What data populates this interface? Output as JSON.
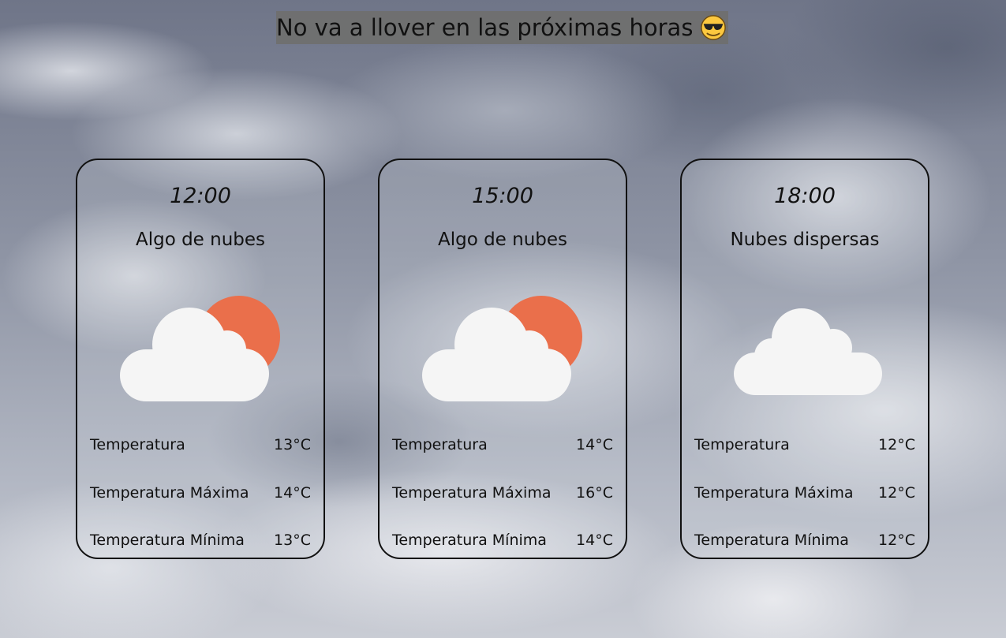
{
  "alert": {
    "text": "No va a llover en las próximas horas",
    "emoji": "sunglasses-emoji"
  },
  "labels": {
    "temp": "Temperatura",
    "temp_max": "Temperatura Máxima",
    "temp_min": "Temperatura Mínima"
  },
  "forecasts": [
    {
      "time": "12:00",
      "description": "Algo de nubes",
      "icon": "partly-cloudy-icon",
      "temp": "13°C",
      "temp_max": "14°C",
      "temp_min": "13°C"
    },
    {
      "time": "15:00",
      "description": "Algo de nubes",
      "icon": "partly-cloudy-icon",
      "temp": "14°C",
      "temp_max": "16°C",
      "temp_min": "14°C"
    },
    {
      "time": "18:00",
      "description": "Nubes dispersas",
      "icon": "cloud-icon",
      "temp": "12°C",
      "temp_max": "12°C",
      "temp_min": "12°C"
    }
  ],
  "colors": {
    "sun": "#ea6f4b",
    "cloud": "#f5f5f5",
    "card_border": "#111111",
    "alert_bg": "#6e6e6c"
  }
}
